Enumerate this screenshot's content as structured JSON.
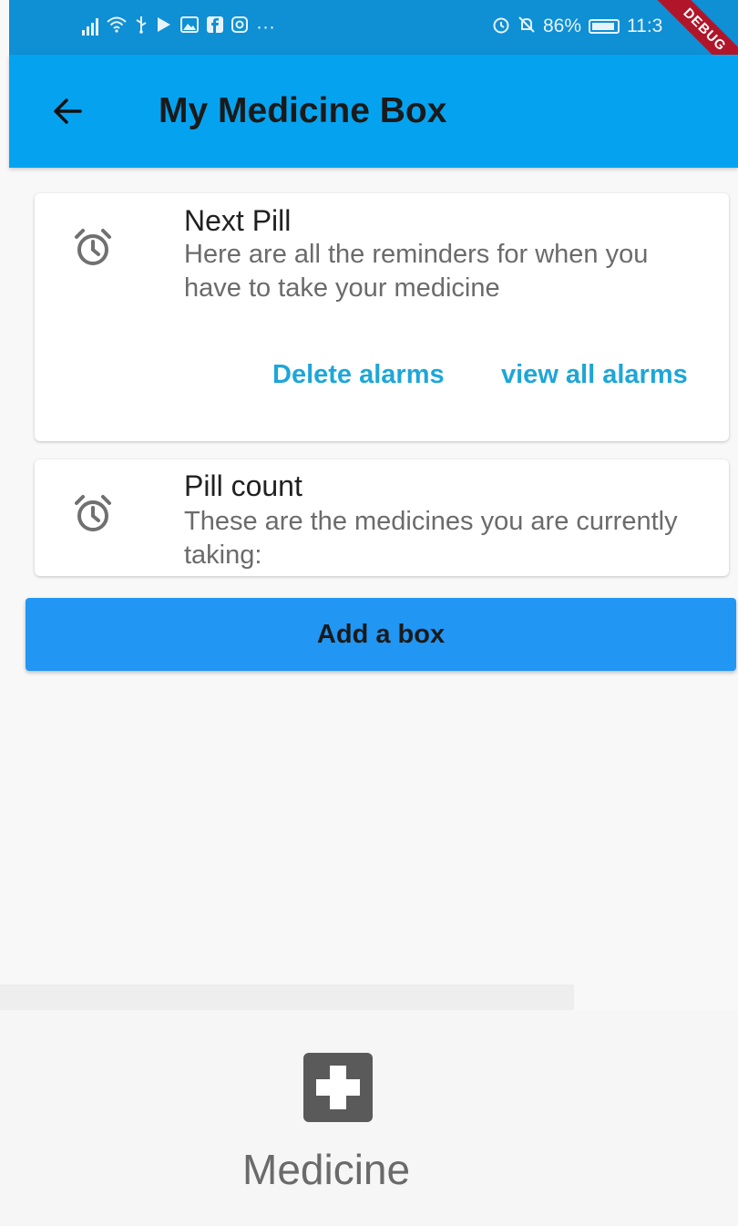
{
  "status_bar": {
    "notification_icons": [
      "signal-icon",
      "wifi-icon",
      "usb-icon",
      "play-store-icon",
      "gallery-icon",
      "facebook-icon",
      "instagram-icon"
    ],
    "more_indicator": "···",
    "battery_percent": "86%",
    "time": "11:3",
    "debug_label": "DEBUG"
  },
  "app_bar": {
    "title": "My Medicine Box"
  },
  "cards": {
    "next_pill": {
      "title": "Next Pill",
      "subtitle": "Here are all the reminders for when you have to take your medicine",
      "delete_label": "Delete alarms",
      "view_all_label": "view all alarms"
    },
    "pill_count": {
      "title": "Pill count",
      "subtitle": "These are the medicines you are currently taking:"
    }
  },
  "add_box": {
    "label": "Add a box"
  },
  "bottom_nav": {
    "label": "Medicine"
  },
  "colors": {
    "status_bar": "#0f8fd4",
    "app_bar": "#05a3ef",
    "action_text": "#1ea6d8",
    "add_button": "#2196f3",
    "debug_banner": "#b0152a"
  }
}
